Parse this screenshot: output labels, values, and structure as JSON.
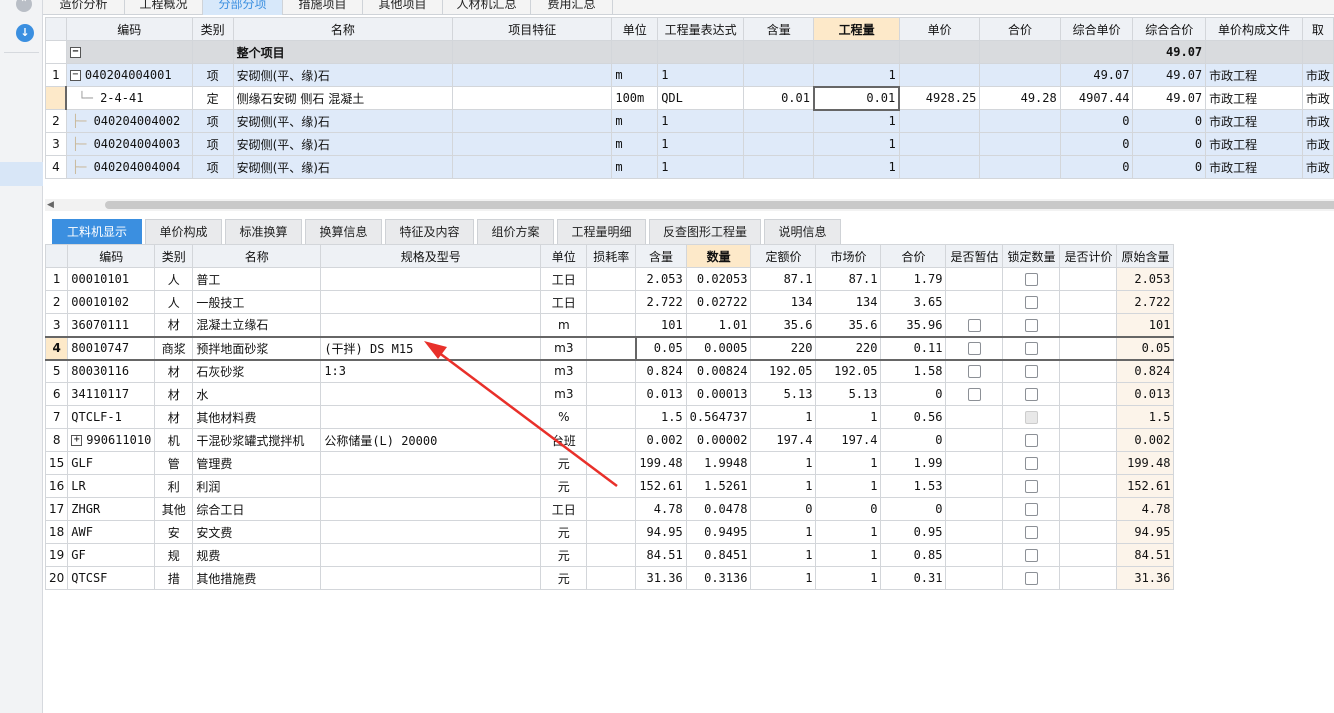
{
  "top_tabs": [
    "造价分析",
    "工程概况",
    "分部分项",
    "措施项目",
    "其他项目",
    "人材机汇总",
    "费用汇总"
  ],
  "top_grid": {
    "headers": [
      "编码",
      "类别",
      "名称",
      "项目特征",
      "单位",
      "工程量表达式",
      "含量",
      "工程量",
      "单价",
      "合价",
      "综合单价",
      "综合合价",
      "单价构成文件",
      "取"
    ],
    "section": {
      "toggle": "−",
      "name": "整个项目",
      "total": "49.07"
    },
    "rows": [
      {
        "no": "1",
        "toggle": "−",
        "code": "040204004001",
        "type": "项",
        "name": "安砌侧(平、缘)石",
        "feature": "",
        "unit": "m",
        "expr": "1",
        "content": "",
        "qty": "1",
        "price": "",
        "total": "",
        "unit_price": "49.07",
        "unit_total": "49.07",
        "file": "市政工程",
        "extra": "市政"
      },
      {
        "no": "",
        "toggle": "",
        "code": "2-4-41",
        "type": "定",
        "name": "侧缘石安砌 侧石 混凝土",
        "feature": "",
        "unit": "100m",
        "expr": "QDL",
        "content": "0.01",
        "qty": "0.01",
        "price": "4928.25",
        "total": "49.28",
        "unit_price": "4907.44",
        "unit_total": "49.07",
        "file": "市政工程",
        "extra": "市政"
      },
      {
        "no": "2",
        "toggle": "",
        "code": "040204004002",
        "type": "项",
        "name": "安砌侧(平、缘)石",
        "feature": "",
        "unit": "m",
        "expr": "1",
        "content": "",
        "qty": "1",
        "price": "",
        "total": "",
        "unit_price": "0",
        "unit_total": "0",
        "file": "市政工程",
        "extra": "市政"
      },
      {
        "no": "3",
        "toggle": "",
        "code": "040204004003",
        "type": "项",
        "name": "安砌侧(平、缘)石",
        "feature": "",
        "unit": "m",
        "expr": "1",
        "content": "",
        "qty": "1",
        "price": "",
        "total": "",
        "unit_price": "0",
        "unit_total": "0",
        "file": "市政工程",
        "extra": "市政"
      },
      {
        "no": "4",
        "toggle": "",
        "code": "040204004004",
        "type": "项",
        "name": "安砌侧(平、缘)石",
        "feature": "",
        "unit": "m",
        "expr": "1",
        "content": "",
        "qty": "1",
        "price": "",
        "total": "",
        "unit_price": "0",
        "unit_total": "0",
        "file": "市政工程",
        "extra": "市政"
      }
    ]
  },
  "bottom_tabs": [
    "工料机显示",
    "单价构成",
    "标准换算",
    "换算信息",
    "特征及内容",
    "组价方案",
    "工程量明细",
    "反查图形工程量",
    "说明信息"
  ],
  "bottom_grid": {
    "headers": [
      "编码",
      "类别",
      "名称",
      "规格及型号",
      "单位",
      "损耗率",
      "含量",
      "数量",
      "定额价",
      "市场价",
      "合价",
      "是否暂估",
      "锁定数量",
      "是否计价",
      "原始含量"
    ],
    "rows": [
      {
        "no": "1",
        "toggle": "",
        "code": "00010101",
        "type": "人",
        "name": "普工",
        "spec": "",
        "unit": "工日",
        "loss": "",
        "content": "2.053",
        "qty": "0.02053",
        "quota": "87.1",
        "market": "87.1",
        "total": "1.79",
        "est": "none",
        "lock": "box",
        "orig": "2.053"
      },
      {
        "no": "2",
        "toggle": "",
        "code": "00010102",
        "type": "人",
        "name": "一般技工",
        "spec": "",
        "unit": "工日",
        "loss": "",
        "content": "2.722",
        "qty": "0.02722",
        "quota": "134",
        "market": "134",
        "total": "3.65",
        "est": "none",
        "lock": "box",
        "orig": "2.722"
      },
      {
        "no": "3",
        "toggle": "",
        "code": "36070111",
        "type": "材",
        "name": "混凝土立缘石",
        "spec": "",
        "unit": "m",
        "loss": "",
        "content": "101",
        "qty": "1.01",
        "quota": "35.6",
        "market": "35.6",
        "total": "35.96",
        "est": "box",
        "lock": "box",
        "orig": "101"
      },
      {
        "no": "4",
        "toggle": "",
        "code": "80010747",
        "type": "商浆",
        "name": "预拌地面砂浆",
        "spec": "(干拌) DS M15",
        "unit": "m3",
        "loss": "",
        "content": "0.05",
        "qty": "0.0005",
        "quota": "220",
        "market": "220",
        "total": "0.11",
        "est": "box",
        "lock": "box",
        "orig": "0.05"
      },
      {
        "no": "5",
        "toggle": "",
        "code": "80030116",
        "type": "材",
        "name": "石灰砂浆",
        "spec": "1:3",
        "unit": "m3",
        "loss": "",
        "content": "0.824",
        "qty": "0.00824",
        "quota": "192.05",
        "market": "192.05",
        "total": "1.58",
        "est": "box",
        "lock": "box",
        "orig": "0.824"
      },
      {
        "no": "6",
        "toggle": "",
        "code": "34110117",
        "type": "材",
        "name": "水",
        "spec": "",
        "unit": "m3",
        "loss": "",
        "content": "0.013",
        "qty": "0.00013",
        "quota": "5.13",
        "market": "5.13",
        "total": "0",
        "est": "box",
        "lock": "box",
        "orig": "0.013"
      },
      {
        "no": "7",
        "toggle": "",
        "code": "QTCLF-1",
        "type": "材",
        "name": "其他材料费",
        "spec": "",
        "unit": "%",
        "loss": "",
        "content": "1.5",
        "qty": "0.564737",
        "quota": "1",
        "market": "1",
        "total": "0.56",
        "est": "none",
        "lock": "dis",
        "orig": "1.5"
      },
      {
        "no": "8",
        "toggle": "+",
        "code": "990611010",
        "type": "机",
        "name": "干混砂浆罐式搅拌机",
        "spec": "公称储量(L) 20000",
        "unit": "台班",
        "loss": "",
        "content": "0.002",
        "qty": "0.00002",
        "quota": "197.4",
        "market": "197.4",
        "total": "0",
        "est": "none",
        "lock": "box",
        "orig": "0.002"
      },
      {
        "no": "15",
        "toggle": "",
        "code": "GLF",
        "type": "管",
        "name": "管理费",
        "spec": "",
        "unit": "元",
        "loss": "",
        "content": "199.48",
        "qty": "1.9948",
        "quota": "1",
        "market": "1",
        "total": "1.99",
        "est": "none",
        "lock": "box",
        "orig": "199.48"
      },
      {
        "no": "16",
        "toggle": "",
        "code": "LR",
        "type": "利",
        "name": "利润",
        "spec": "",
        "unit": "元",
        "loss": "",
        "content": "152.61",
        "qty": "1.5261",
        "quota": "1",
        "market": "1",
        "total": "1.53",
        "est": "none",
        "lock": "box",
        "orig": "152.61"
      },
      {
        "no": "17",
        "toggle": "",
        "code": "ZHGR",
        "type": "其他",
        "name": "综合工日",
        "spec": "",
        "unit": "工日",
        "loss": "",
        "content": "4.78",
        "qty": "0.0478",
        "quota": "0",
        "market": "0",
        "total": "0",
        "est": "none",
        "lock": "box",
        "orig": "4.78"
      },
      {
        "no": "18",
        "toggle": "",
        "code": "AWF",
        "type": "安",
        "name": "安文费",
        "spec": "",
        "unit": "元",
        "loss": "",
        "content": "94.95",
        "qty": "0.9495",
        "quota": "1",
        "market": "1",
        "total": "0.95",
        "est": "none",
        "lock": "box",
        "orig": "94.95"
      },
      {
        "no": "19",
        "toggle": "",
        "code": "GF",
        "type": "规",
        "name": "规费",
        "spec": "",
        "unit": "元",
        "loss": "",
        "content": "84.51",
        "qty": "0.8451",
        "quota": "1",
        "market": "1",
        "total": "0.85",
        "est": "none",
        "lock": "box",
        "orig": "84.51"
      },
      {
        "no": "20",
        "toggle": "",
        "code": "QTCSF",
        "type": "措",
        "name": "其他措施费",
        "spec": "",
        "unit": "元",
        "loss": "",
        "content": "31.36",
        "qty": "0.3136",
        "quota": "1",
        "market": "1",
        "total": "0.31",
        "est": "none",
        "lock": "box",
        "orig": "31.36"
      }
    ]
  },
  "colors": {
    "accent": "#3b8fe0",
    "header_highlight": "#fde9c9",
    "row_blue": "#dfeaf9",
    "annotation_arrow": "#e8302a"
  }
}
